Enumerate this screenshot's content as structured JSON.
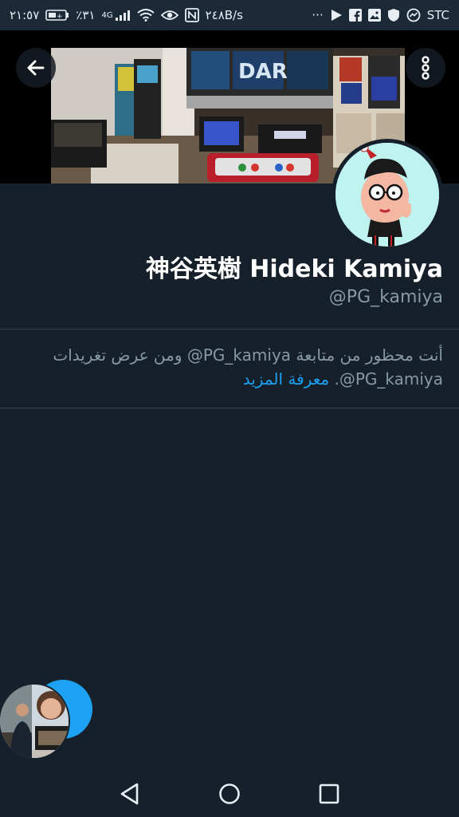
{
  "status_bar": {
    "time": "٢١:٥٧",
    "battery_percent": "٪٣١",
    "network": "4G",
    "speed": "٢٤٨B/s",
    "more": "···",
    "carrier": "STC"
  },
  "profile": {
    "name": "神谷英樹 Hideki Kamiya",
    "handle": "@PG_kamiya"
  },
  "blocked_notice": {
    "text": "أنت محظور من متابعة ‎@PG_kamiya‎ ومن عرض تغريدات ‎@PG_kamiya‎.",
    "learn_more": "معرفة المزيد"
  },
  "colors": {
    "background": "#15202b",
    "accent": "#1da1f2",
    "muted_text": "#8899a6",
    "divider": "#38444d"
  },
  "icons": {
    "back": "back-arrow-icon",
    "more": "more-vertical-icon",
    "nav_back": "triangle-back-icon",
    "nav_home": "circle-home-icon",
    "nav_recents": "square-recents-icon"
  }
}
